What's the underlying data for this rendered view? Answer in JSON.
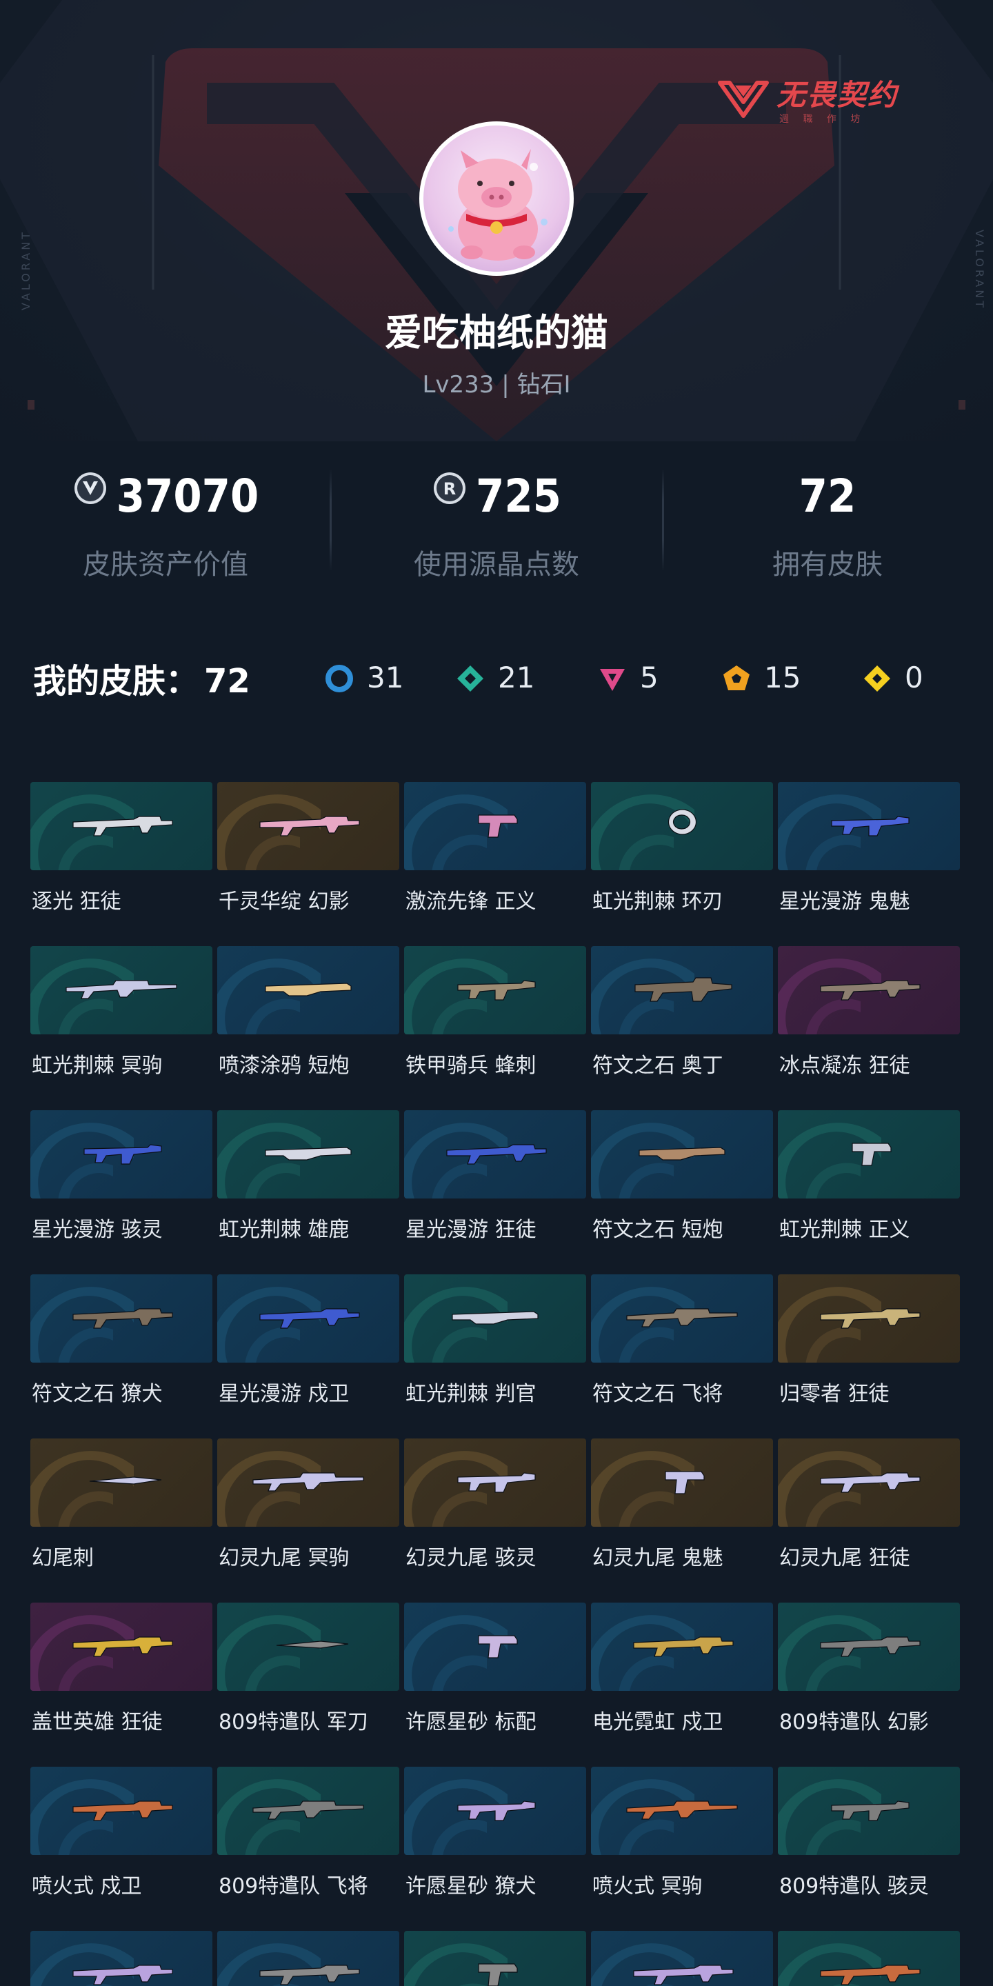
{
  "brand": {
    "title": "无畏契约",
    "subtitle": "週 職 作 坊",
    "side_text": "VALORANT"
  },
  "profile": {
    "username": "爱吃柚纸的猫",
    "level": "Lv233 | 钻石I"
  },
  "stats": [
    {
      "value": "37070",
      "label": "皮肤资产价值",
      "icon": "valorant-points-icon"
    },
    {
      "value": "725",
      "label": "使用源晶点数",
      "icon": "radianite-icon"
    },
    {
      "value": "72",
      "label": "拥有皮肤",
      "icon": ""
    }
  ],
  "skins": {
    "title": "我的皮肤：",
    "count": "72",
    "tiers": [
      {
        "name": "select",
        "count": "31",
        "color": "#2f8fd8"
      },
      {
        "name": "deluxe",
        "count": "21",
        "color": "#27b39a"
      },
      {
        "name": "premium",
        "count": "5",
        "color": "#e04a8a"
      },
      {
        "name": "exclusive",
        "count": "15",
        "color": "#f0a11f"
      },
      {
        "name": "ultra",
        "count": "0",
        "color": "#f5d020"
      }
    ],
    "items": [
      {
        "name": "逐光 狂徒",
        "bg": "teal",
        "weapon": "rifle",
        "tint": "#d9dbe2"
      },
      {
        "name": "千灵华绽 幻影",
        "bg": "gold",
        "weapon": "rifle",
        "tint": "#e7a7c4"
      },
      {
        "name": "激流先锋 正义",
        "bg": "blue",
        "weapon": "pistol",
        "tint": "#d58ab9"
      },
      {
        "name": "虹光荆棘 环刃",
        "bg": "teal",
        "weapon": "ring",
        "tint": "#d9dce6"
      },
      {
        "name": "星光漫游 鬼魅",
        "bg": "blue",
        "weapon": "smg",
        "tint": "#4a63d9"
      },
      {
        "name": "虹光荆棘 冥驹",
        "bg": "teal",
        "weapon": "sniper",
        "tint": "#c7c9e6"
      },
      {
        "name": "喷漆涂鸦 短炮",
        "bg": "blue",
        "weapon": "shotgun",
        "tint": "#e3c48a"
      },
      {
        "name": "铁甲骑兵 蜂刺",
        "bg": "teal",
        "weapon": "smg",
        "tint": "#9c8c74"
      },
      {
        "name": "符文之石 奥丁",
        "bg": "blue",
        "weapon": "lmg",
        "tint": "#7c6d5c"
      },
      {
        "name": "冰点凝冻 狂徒",
        "bg": "magenta",
        "weapon": "rifle",
        "tint": "#8d7f70"
      },
      {
        "name": "星光漫游 骇灵",
        "bg": "blue",
        "weapon": "smg",
        "tint": "#3f5bd0"
      },
      {
        "name": "虹光荆棘 雄鹿",
        "bg": "teal",
        "weapon": "shotgun",
        "tint": "#d5d8e4"
      },
      {
        "name": "星光漫游 狂徒",
        "bg": "blue",
        "weapon": "rifle",
        "tint": "#3f5bd0"
      },
      {
        "name": "符文之石 短炮",
        "bg": "blue",
        "weapon": "shotgun",
        "tint": "#b08a6a"
      },
      {
        "name": "虹光荆棘 正义",
        "bg": "teal",
        "weapon": "pistol",
        "tint": "#c7c9d6"
      },
      {
        "name": "符文之石 獠犬",
        "bg": "blue",
        "weapon": "rifle",
        "tint": "#7c6d5c"
      },
      {
        "name": "星光漫游 戍卫",
        "bg": "blue",
        "weapon": "rifle",
        "tint": "#3f5bd0"
      },
      {
        "name": "虹光荆棘 判官",
        "bg": "teal",
        "weapon": "shotgun",
        "tint": "#d0d3e2"
      },
      {
        "name": "符文之石 飞将",
        "bg": "blue",
        "weapon": "sniper",
        "tint": "#8a7c6b"
      },
      {
        "name": "归零者 狂徒",
        "bg": "gold",
        "weapon": "rifle",
        "tint": "#c9b37a"
      },
      {
        "name": "幻尾刺",
        "bg": "gold",
        "weapon": "knife",
        "tint": "#c8c9e8"
      },
      {
        "name": "幻灵九尾 冥驹",
        "bg": "gold",
        "weapon": "sniper",
        "tint": "#c6c4ea"
      },
      {
        "name": "幻灵九尾 骇灵",
        "bg": "gold",
        "weapon": "smg",
        "tint": "#c6c4ea"
      },
      {
        "name": "幻灵九尾 鬼魅",
        "bg": "gold",
        "weapon": "pistol",
        "tint": "#c6c4ea"
      },
      {
        "name": "幻灵九尾 狂徒",
        "bg": "gold",
        "weapon": "rifle",
        "tint": "#c6c4ea"
      },
      {
        "name": "盖世英雄 狂徒",
        "bg": "magenta",
        "weapon": "rifle",
        "tint": "#d8b03a"
      },
      {
        "name": "809特遣队 军刀",
        "bg": "teal",
        "weapon": "knife",
        "tint": "#8c8c8c"
      },
      {
        "name": "许愿星砂 标配",
        "bg": "blue",
        "weapon": "pistol",
        "tint": "#c9b7e0"
      },
      {
        "name": "电光霓虹 戍卫",
        "bg": "blue",
        "weapon": "rifle",
        "tint": "#c9a44a"
      },
      {
        "name": "809特遣队 幻影",
        "bg": "teal",
        "weapon": "rifle",
        "tint": "#7e7e7e"
      },
      {
        "name": "喷火式 戍卫",
        "bg": "blue",
        "weapon": "rifle",
        "tint": "#c86b3e"
      },
      {
        "name": "809特遣队 飞将",
        "bg": "teal",
        "weapon": "sniper",
        "tint": "#7e7e7e"
      },
      {
        "name": "许愿星砂 獠犬",
        "bg": "blue",
        "weapon": "smg",
        "tint": "#b9a3de"
      },
      {
        "name": "喷火式 冥驹",
        "bg": "blue",
        "weapon": "sniper",
        "tint": "#c86b3e"
      },
      {
        "name": "809特遣队 骇灵",
        "bg": "teal",
        "weapon": "smg",
        "tint": "#7e7e7e"
      },
      {
        "name": "",
        "bg": "blue",
        "weapon": "rifle",
        "tint": "#b9a3de"
      },
      {
        "name": "",
        "bg": "blue",
        "weapon": "rifle",
        "tint": "#8a8a8a"
      },
      {
        "name": "",
        "bg": "teal",
        "weapon": "pistol",
        "tint": "#8a8a8a"
      },
      {
        "name": "",
        "bg": "blue",
        "weapon": "rifle",
        "tint": "#b9a3de"
      },
      {
        "name": "",
        "bg": "teal",
        "weapon": "rifle",
        "tint": "#c86b3e"
      }
    ]
  }
}
